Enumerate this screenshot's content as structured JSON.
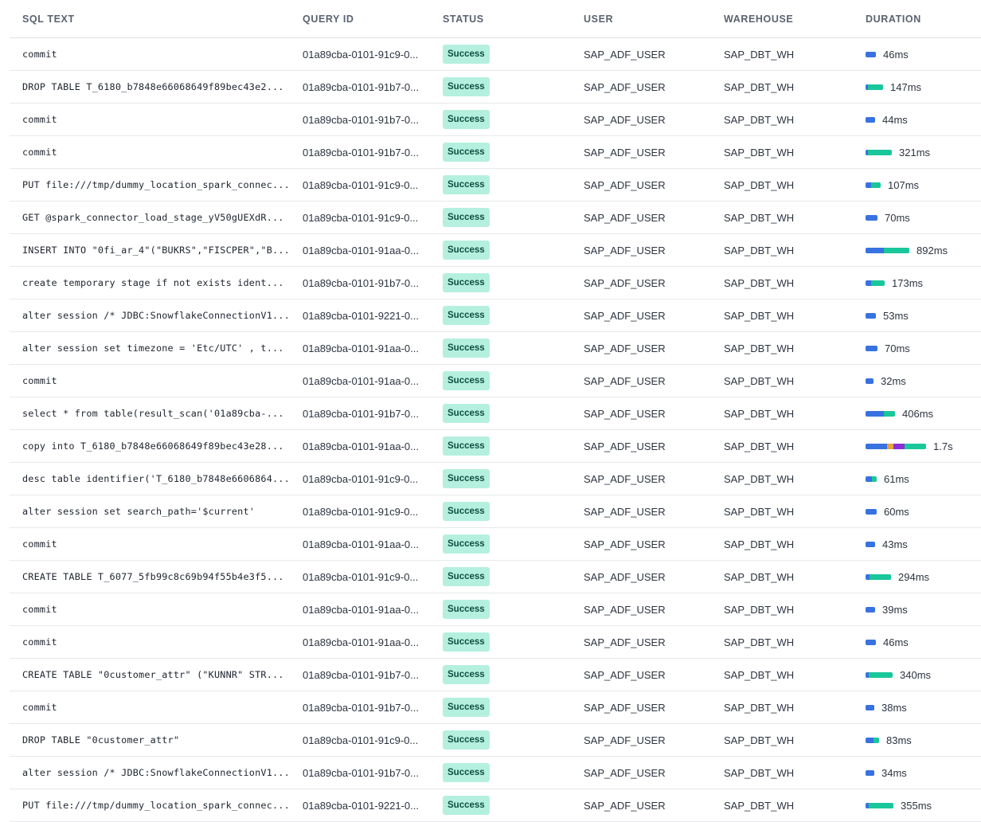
{
  "headers": {
    "sql_text": "SQL TEXT",
    "query_id": "QUERY ID",
    "status": "STATUS",
    "user": "USER",
    "warehouse": "WAREHOUSE",
    "duration": "DURATION"
  },
  "colors": {
    "seg_blue": "#3772e0",
    "seg_green": "#19c79a",
    "seg_orange": "#e8a33d",
    "seg_purple": "#8b2ed4",
    "badge_bg": "#b5f0df",
    "badge_text": "#0e4f3f"
  },
  "rows": [
    {
      "sql": "commit",
      "qid": "01a89cba-0101-91c9-0...",
      "status": "Success",
      "user": "SAP_ADF_USER",
      "wh": "SAP_DBT_WH",
      "duration": "46ms",
      "duration_ms": 46,
      "segments": [
        {
          "color": "seg_blue",
          "fraction": 1.0
        }
      ]
    },
    {
      "sql": "DROP TABLE T_6180_b7848e66068649f89bec43e2...",
      "qid": "01a89cba-0101-91b7-0...",
      "status": "Success",
      "user": "SAP_ADF_USER",
      "wh": "SAP_DBT_WH",
      "duration": "147ms",
      "duration_ms": 147,
      "segments": [
        {
          "color": "seg_blue",
          "fraction": 0.15
        },
        {
          "color": "seg_green",
          "fraction": 0.85
        }
      ]
    },
    {
      "sql": "commit",
      "qid": "01a89cba-0101-91b7-0...",
      "status": "Success",
      "user": "SAP_ADF_USER",
      "wh": "SAP_DBT_WH",
      "duration": "44ms",
      "duration_ms": 44,
      "segments": [
        {
          "color": "seg_blue",
          "fraction": 1.0
        }
      ]
    },
    {
      "sql": "commit",
      "qid": "01a89cba-0101-91b7-0...",
      "status": "Success",
      "user": "SAP_ADF_USER",
      "wh": "SAP_DBT_WH",
      "duration": "321ms",
      "duration_ms": 321,
      "segments": [
        {
          "color": "seg_blue",
          "fraction": 0.1
        },
        {
          "color": "seg_green",
          "fraction": 0.9
        }
      ]
    },
    {
      "sql": "PUT file:///tmp/dummy_location_spark_connec...",
      "qid": "01a89cba-0101-91c9-0...",
      "status": "Success",
      "user": "SAP_ADF_USER",
      "wh": "SAP_DBT_WH",
      "duration": "107ms",
      "duration_ms": 107,
      "segments": [
        {
          "color": "seg_blue",
          "fraction": 0.35
        },
        {
          "color": "seg_green",
          "fraction": 0.65
        }
      ]
    },
    {
      "sql": "GET @spark_connector_load_stage_yV50gUEXdR...",
      "qid": "01a89cba-0101-91c9-0...",
      "status": "Success",
      "user": "SAP_ADF_USER",
      "wh": "SAP_DBT_WH",
      "duration": "70ms",
      "duration_ms": 70,
      "segments": [
        {
          "color": "seg_blue",
          "fraction": 1.0
        }
      ]
    },
    {
      "sql": "INSERT INTO \"0fi_ar_4\"(\"BUKRS\",\"FISCPER\",\"B...",
      "qid": "01a89cba-0101-91aa-0...",
      "status": "Success",
      "user": "SAP_ADF_USER",
      "wh": "SAP_DBT_WH",
      "duration": "892ms",
      "duration_ms": 892,
      "segments": [
        {
          "color": "seg_blue",
          "fraction": 0.42
        },
        {
          "color": "seg_green",
          "fraction": 0.58
        }
      ]
    },
    {
      "sql": "create temporary stage if not exists ident...",
      "qid": "01a89cba-0101-91b7-0...",
      "status": "Success",
      "user": "SAP_ADF_USER",
      "wh": "SAP_DBT_WH",
      "duration": "173ms",
      "duration_ms": 173,
      "segments": [
        {
          "color": "seg_blue",
          "fraction": 0.3
        },
        {
          "color": "seg_green",
          "fraction": 0.7
        }
      ]
    },
    {
      "sql": "alter session /* JDBC:SnowflakeConnectionV1...",
      "qid": "01a89cba-0101-9221-0...",
      "status": "Success",
      "user": "SAP_ADF_USER",
      "wh": "SAP_DBT_WH",
      "duration": "53ms",
      "duration_ms": 53,
      "segments": [
        {
          "color": "seg_blue",
          "fraction": 1.0
        }
      ]
    },
    {
      "sql": "alter session set timezone = 'Etc/UTC' , t...",
      "qid": "01a89cba-0101-91aa-0...",
      "status": "Success",
      "user": "SAP_ADF_USER",
      "wh": "SAP_DBT_WH",
      "duration": "70ms",
      "duration_ms": 70,
      "segments": [
        {
          "color": "seg_blue",
          "fraction": 1.0
        }
      ]
    },
    {
      "sql": "commit",
      "qid": "01a89cba-0101-91aa-0...",
      "status": "Success",
      "user": "SAP_ADF_USER",
      "wh": "SAP_DBT_WH",
      "duration": "32ms",
      "duration_ms": 32,
      "segments": [
        {
          "color": "seg_blue",
          "fraction": 1.0
        }
      ]
    },
    {
      "sql": "select * from table(result_scan('01a89cba-...",
      "qid": "01a89cba-0101-91b7-0...",
      "status": "Success",
      "user": "SAP_ADF_USER",
      "wh": "SAP_DBT_WH",
      "duration": "406ms",
      "duration_ms": 406,
      "segments": [
        {
          "color": "seg_blue",
          "fraction": 0.62
        },
        {
          "color": "seg_green",
          "fraction": 0.38
        }
      ]
    },
    {
      "sql": "copy into T_6180_b7848e66068649f89bec43e28...",
      "qid": "01a89cba-0101-91aa-0...",
      "status": "Success",
      "user": "SAP_ADF_USER",
      "wh": "SAP_DBT_WH",
      "duration": "1.7s",
      "duration_ms": 1700,
      "segments": [
        {
          "color": "seg_blue",
          "fraction": 0.36
        },
        {
          "color": "seg_orange",
          "fraction": 0.1
        },
        {
          "color": "seg_purple",
          "fraction": 0.19
        },
        {
          "color": "seg_green",
          "fraction": 0.35
        }
      ]
    },
    {
      "sql": "desc table identifier('T_6180_b7848e6606864...",
      "qid": "01a89cba-0101-91c9-0...",
      "status": "Success",
      "user": "SAP_ADF_USER",
      "wh": "SAP_DBT_WH",
      "duration": "61ms",
      "duration_ms": 61,
      "segments": [
        {
          "color": "seg_blue",
          "fraction": 0.6
        },
        {
          "color": "seg_green",
          "fraction": 0.4
        }
      ]
    },
    {
      "sql": "alter session set search_path='$current'",
      "qid": "01a89cba-0101-91c9-0...",
      "status": "Success",
      "user": "SAP_ADF_USER",
      "wh": "SAP_DBT_WH",
      "duration": "60ms",
      "duration_ms": 60,
      "segments": [
        {
          "color": "seg_blue",
          "fraction": 1.0
        }
      ]
    },
    {
      "sql": "commit",
      "qid": "01a89cba-0101-91aa-0...",
      "status": "Success",
      "user": "SAP_ADF_USER",
      "wh": "SAP_DBT_WH",
      "duration": "43ms",
      "duration_ms": 43,
      "segments": [
        {
          "color": "seg_blue",
          "fraction": 1.0
        }
      ]
    },
    {
      "sql": "CREATE TABLE T_6077_5fb99c8c69b94f55b4e3f5...",
      "qid": "01a89cba-0101-91c9-0...",
      "status": "Success",
      "user": "SAP_ADF_USER",
      "wh": "SAP_DBT_WH",
      "duration": "294ms",
      "duration_ms": 294,
      "segments": [
        {
          "color": "seg_blue",
          "fraction": 0.15
        },
        {
          "color": "seg_green",
          "fraction": 0.85
        }
      ]
    },
    {
      "sql": "commit",
      "qid": "01a89cba-0101-91aa-0...",
      "status": "Success",
      "user": "SAP_ADF_USER",
      "wh": "SAP_DBT_WH",
      "duration": "39ms",
      "duration_ms": 39,
      "segments": [
        {
          "color": "seg_blue",
          "fraction": 1.0
        }
      ]
    },
    {
      "sql": "commit",
      "qid": "01a89cba-0101-91aa-0...",
      "status": "Success",
      "user": "SAP_ADF_USER",
      "wh": "SAP_DBT_WH",
      "duration": "46ms",
      "duration_ms": 46,
      "segments": [
        {
          "color": "seg_blue",
          "fraction": 1.0
        }
      ]
    },
    {
      "sql": "CREATE TABLE \"0customer_attr\" (\"KUNNR\" STR...",
      "qid": "01a89cba-0101-91b7-0...",
      "status": "Success",
      "user": "SAP_ADF_USER",
      "wh": "SAP_DBT_WH",
      "duration": "340ms",
      "duration_ms": 340,
      "segments": [
        {
          "color": "seg_blue",
          "fraction": 0.12
        },
        {
          "color": "seg_green",
          "fraction": 0.88
        }
      ]
    },
    {
      "sql": "commit",
      "qid": "01a89cba-0101-91b7-0...",
      "status": "Success",
      "user": "SAP_ADF_USER",
      "wh": "SAP_DBT_WH",
      "duration": "38ms",
      "duration_ms": 38,
      "segments": [
        {
          "color": "seg_blue",
          "fraction": 1.0
        }
      ]
    },
    {
      "sql": "DROP TABLE \"0customer_attr\"",
      "qid": "01a89cba-0101-91c9-0...",
      "status": "Success",
      "user": "SAP_ADF_USER",
      "wh": "SAP_DBT_WH",
      "duration": "83ms",
      "duration_ms": 83,
      "segments": [
        {
          "color": "seg_blue",
          "fraction": 0.6
        },
        {
          "color": "seg_green",
          "fraction": 0.4
        }
      ]
    },
    {
      "sql": "alter session /* JDBC:SnowflakeConnectionV1...",
      "qid": "01a89cba-0101-91b7-0...",
      "status": "Success",
      "user": "SAP_ADF_USER",
      "wh": "SAP_DBT_WH",
      "duration": "34ms",
      "duration_ms": 34,
      "segments": [
        {
          "color": "seg_blue",
          "fraction": 1.0
        }
      ]
    },
    {
      "sql": "PUT file:///tmp/dummy_location_spark_connec...",
      "qid": "01a89cba-0101-9221-0...",
      "status": "Success",
      "user": "SAP_ADF_USER",
      "wh": "SAP_DBT_WH",
      "duration": "355ms",
      "duration_ms": 355,
      "segments": [
        {
          "color": "seg_blue",
          "fraction": 0.1
        },
        {
          "color": "seg_green",
          "fraction": 0.9
        }
      ]
    }
  ]
}
